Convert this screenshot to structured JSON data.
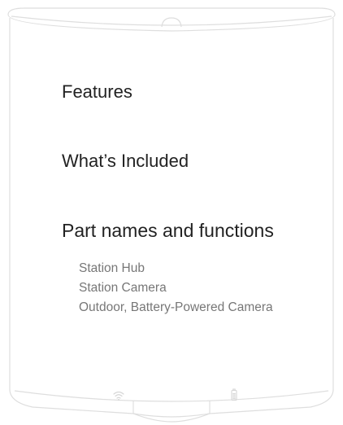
{
  "menu": {
    "headings": {
      "features": "Features",
      "whats_included": "What’s Included",
      "part_names": "Part names and functions"
    },
    "part_items": [
      "Station Hub",
      "Station Camera",
      "Outdoor, Battery-Powered Camera"
    ]
  },
  "icons": {
    "status_left": "wifi-icon",
    "status_right": "battery-icon"
  },
  "colors": {
    "heading": "#222222",
    "subitem": "#777777",
    "outline": "#dddddd"
  }
}
